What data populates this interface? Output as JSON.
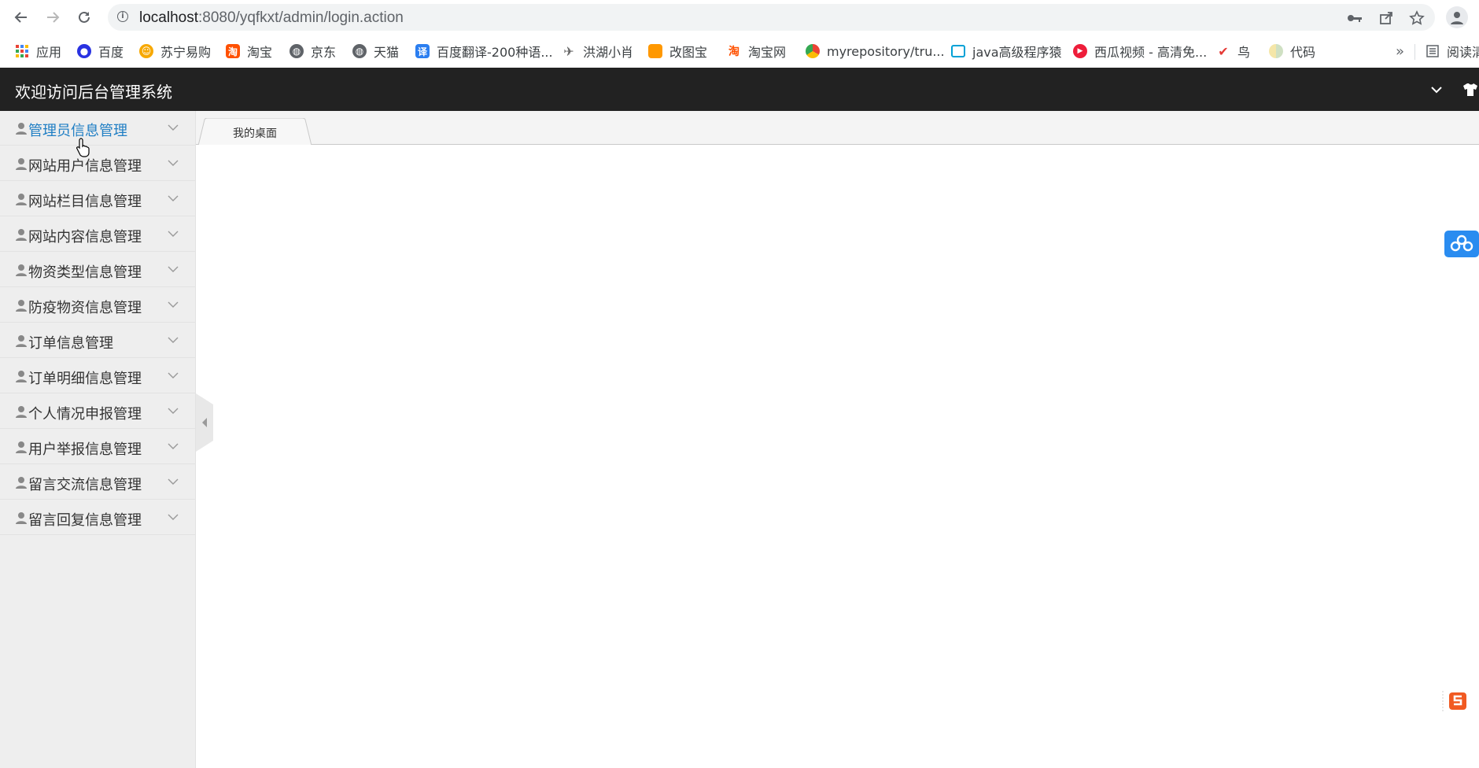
{
  "browser": {
    "url_host": "localhost",
    "url_path": ":8080/yqfkxt/admin/login.action",
    "bookmarks": [
      {
        "label": "应用",
        "icon": "apps-grid-icon"
      },
      {
        "label": "百度",
        "icon": "baidu-paw-icon"
      },
      {
        "label": "苏宁易购",
        "icon": "suning-icon"
      },
      {
        "label": "淘宝",
        "icon": "taobao-icon"
      },
      {
        "label": "京东",
        "icon": "globe-icon"
      },
      {
        "label": "天猫",
        "icon": "globe-icon"
      },
      {
        "label": "百度翻译-200种语...",
        "icon": "baidu-translate-icon"
      },
      {
        "label": "洪湖小肖",
        "icon": "bird-icon"
      },
      {
        "label": "改图宝",
        "icon": "gaitubao-icon"
      },
      {
        "label": "淘宝网",
        "icon": "taobao-text-icon"
      },
      {
        "label": "myrepository/tru...",
        "icon": "chrome-icon"
      },
      {
        "label": "java高级程序猿",
        "icon": "bilibili-tv-icon"
      },
      {
        "label": "西瓜视频 - 高清免...",
        "icon": "xigua-play-icon"
      },
      {
        "label": "鸟",
        "icon": "red-bird-icon"
      },
      {
        "label": "代码",
        "icon": "moon-icon"
      }
    ],
    "overflow_label": "»",
    "reading_list_label": "阅读清"
  },
  "app": {
    "title": "欢迎访问后台管理系统"
  },
  "sidebar": {
    "items": [
      {
        "label": "管理员信息管理",
        "active": true
      },
      {
        "label": "网站用户信息管理"
      },
      {
        "label": "网站栏目信息管理"
      },
      {
        "label": "网站内容信息管理"
      },
      {
        "label": "物资类型信息管理"
      },
      {
        "label": "防疫物资信息管理"
      },
      {
        "label": "订单信息管理"
      },
      {
        "label": "订单明细信息管理"
      },
      {
        "label": "个人情况申报管理"
      },
      {
        "label": "用户举报信息管理"
      },
      {
        "label": "留言交流信息管理"
      },
      {
        "label": "留言回复信息管理"
      }
    ]
  },
  "tabs": [
    {
      "label": "我的桌面"
    }
  ],
  "colors": {
    "header_bg": "#222222",
    "sidebar_bg": "#eeeeee",
    "active_link": "#1f7ec4",
    "float_blue": "#2a8cf0",
    "float_orange": "#f15a22"
  }
}
